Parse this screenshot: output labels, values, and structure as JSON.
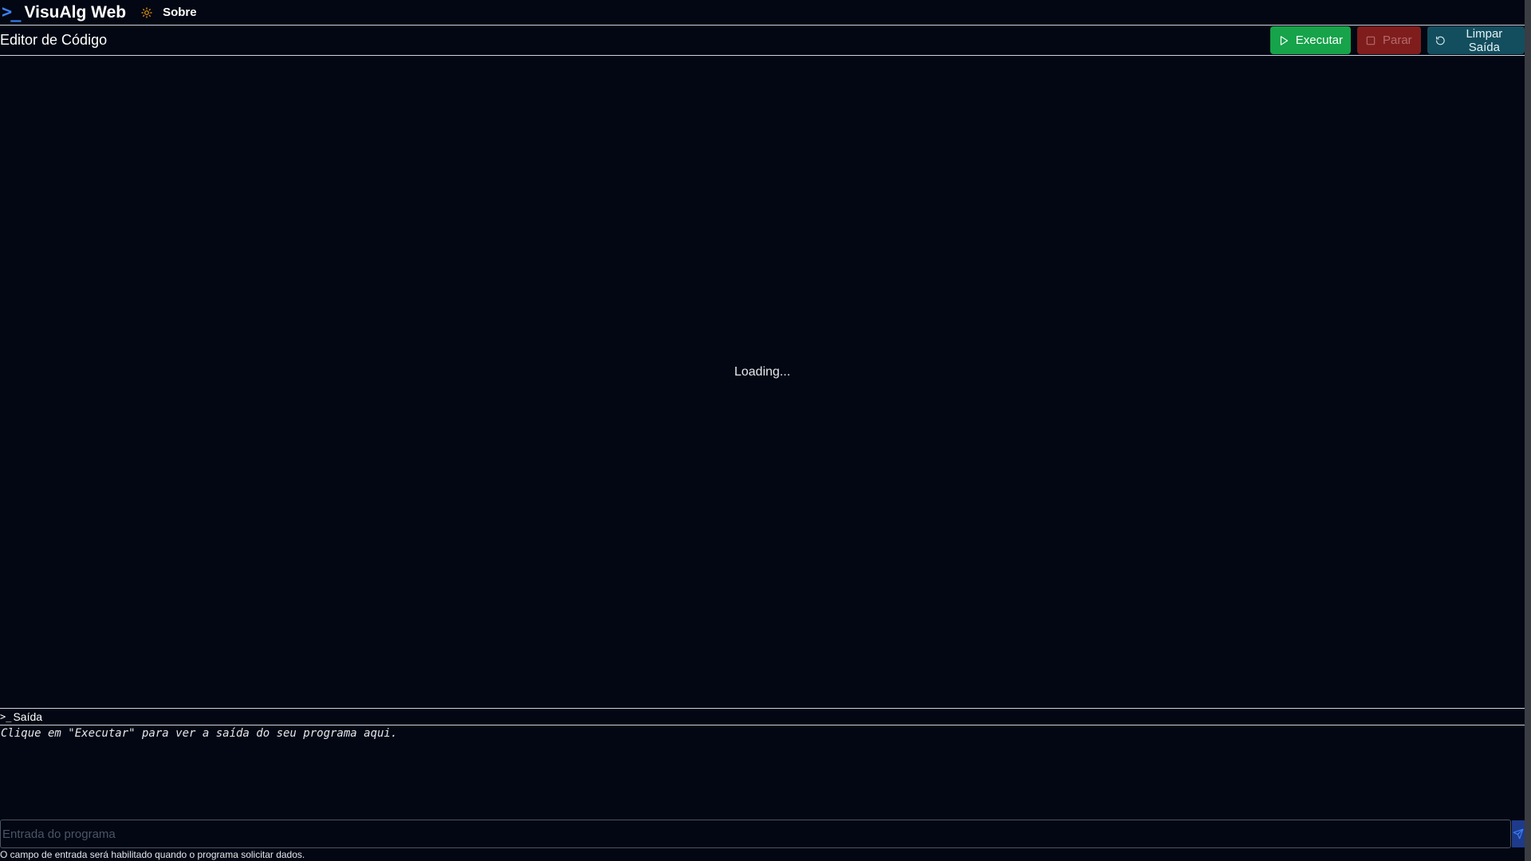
{
  "header": {
    "logo_symbol": ">_",
    "app_name": "VisuAlg Web",
    "theme_icon": "sun-icon",
    "about_label": "Sobre"
  },
  "editor": {
    "title": "Editor de Código",
    "loading_text": "Loading...",
    "actions": {
      "run_label": "Executar",
      "stop_label": "Parar",
      "clear_label": "Limpar Saída"
    }
  },
  "output": {
    "prompt_symbol": ">_",
    "title": "Saída",
    "placeholder": "Clique em \"Executar\" para ver a saída do seu programa aqui."
  },
  "input": {
    "placeholder": "Entrada do programa",
    "value": "",
    "hint": "O campo de entrada será habilitado quando o programa solicitar dados.",
    "send_icon": "send-icon"
  },
  "colors": {
    "background": "#020713",
    "accent": "#3b82f6",
    "run": "#16a34a",
    "stop": "#7f1d1d",
    "clear": "#134e5e",
    "theme_icon": "#f59e0b"
  }
}
